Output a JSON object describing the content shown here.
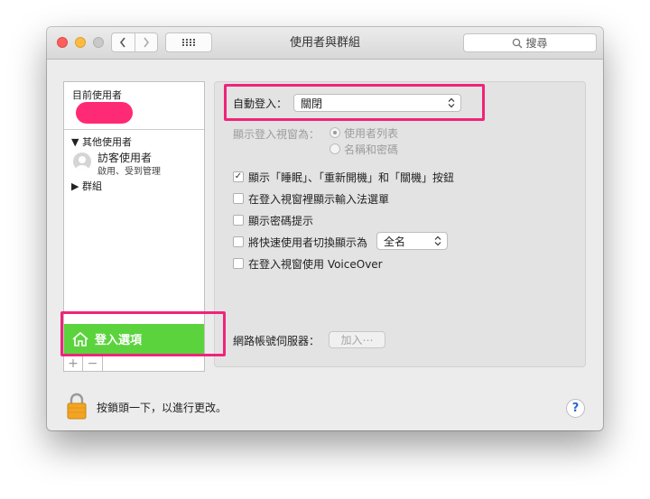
{
  "window": {
    "title": "使用者與群組",
    "search_placeholder": "搜尋"
  },
  "sidebar": {
    "current_user_header": "目前使用者",
    "other_users_header": "其他使用者",
    "guest_name": "訪客使用者",
    "guest_status": "啟用、受到管理",
    "groups_header": "群組",
    "login_options": "登入選項",
    "add_symbol": "+",
    "remove_symbol": "−"
  },
  "panel": {
    "auto_login_label": "自動登入：",
    "auto_login_value": "關閉",
    "display_login_label": "顯示登入視窗為：",
    "radio_options": [
      {
        "label": "使用者列表",
        "selected": true,
        "enabled": false
      },
      {
        "label": "名稱和密碼",
        "selected": false,
        "enabled": false
      }
    ],
    "checkboxes": [
      {
        "label": "顯示「睡眠」、「重新開機」和「關機」按鈕",
        "checked": true
      },
      {
        "label": "在登入視窗裡顯示輸入法選單",
        "checked": false
      },
      {
        "label": "顯示密碼提示",
        "checked": false
      },
      {
        "label": "將快速使用者切換顯示為",
        "checked": false
      },
      {
        "label": "在登入視窗使用 VoiceOver",
        "checked": false
      }
    ],
    "fast_switch_value": "全名",
    "network_server_label": "網路帳號伺服器：",
    "join_button": "加入⋯"
  },
  "footer": {
    "lock_text": "按鎖頭一下，以進行更改。",
    "help_symbol": "?"
  },
  "colors": {
    "highlight": "#f0237a",
    "selected_item": "#5bd33d",
    "redaction": "#ff2a75"
  }
}
